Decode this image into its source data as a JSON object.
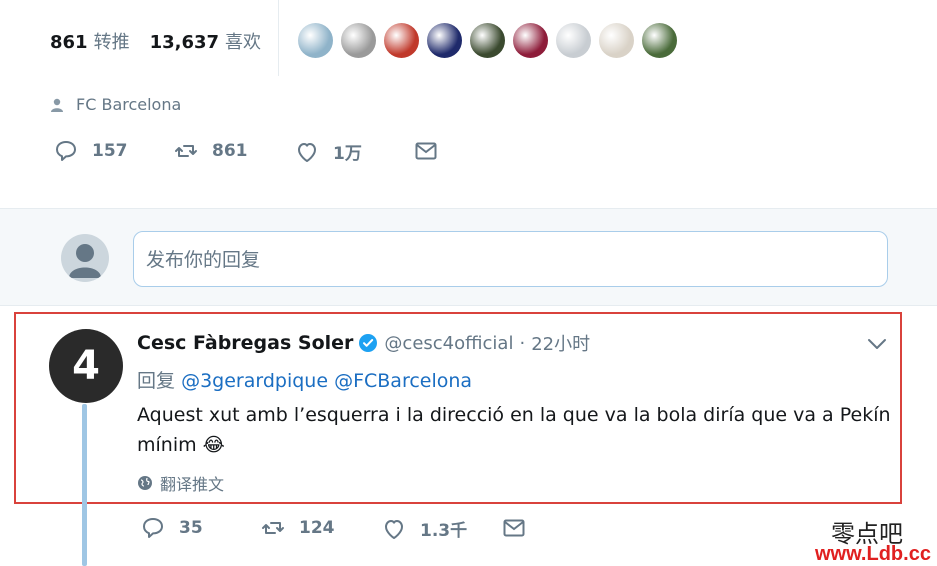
{
  "stats": {
    "retweets_count": "861",
    "retweets_label": "转推",
    "likes_count": "13,637",
    "likes_label": "喜欢"
  },
  "liker_avatars": [
    {
      "color": "#8fb3c9"
    },
    {
      "color": "#9a9a9a"
    },
    {
      "color": "#c0392b"
    },
    {
      "color": "#1f2a6b"
    },
    {
      "color": "#3b4a2f"
    },
    {
      "color": "#8e1d3a"
    },
    {
      "color": "#c8cdd2"
    },
    {
      "color": "#d9d2c7"
    },
    {
      "color": "#4a6b3a"
    }
  ],
  "location": {
    "icon": "person-icon",
    "text": "FC Barcelona"
  },
  "main_actions": {
    "replies": "157",
    "retweets": "861",
    "likes": "1万"
  },
  "reply_box": {
    "placeholder": "发布你的回复"
  },
  "reply_tweet": {
    "author_name": "Cesc Fàbregas Soler",
    "verified": true,
    "handle": "@cesc4official",
    "separator": "·",
    "time": "22小时",
    "reply_prefix": "回复",
    "mention_1": "@3gerardpique",
    "mention_2": "@FCBarcelona",
    "text_line_1": "Aquest xut amb l’esquerra i la direcció en la que va la bola diría que va a Pekín",
    "text_line_2": "mínim",
    "emoji": "😂",
    "translate_label": "翻译推文",
    "avatar_glyph": "4",
    "avatar_accent": "`",
    "actions": {
      "replies": "35",
      "retweets": "124",
      "likes": "1.3千"
    }
  },
  "watermark": {
    "chinese": "零点吧",
    "url": "www.Ldb.cc"
  },
  "colors": {
    "accent_blue": "#1da1f2",
    "link_blue": "#1b6ec2",
    "highlight_red": "#d9423c",
    "thread_line": "#9fc6e4"
  }
}
